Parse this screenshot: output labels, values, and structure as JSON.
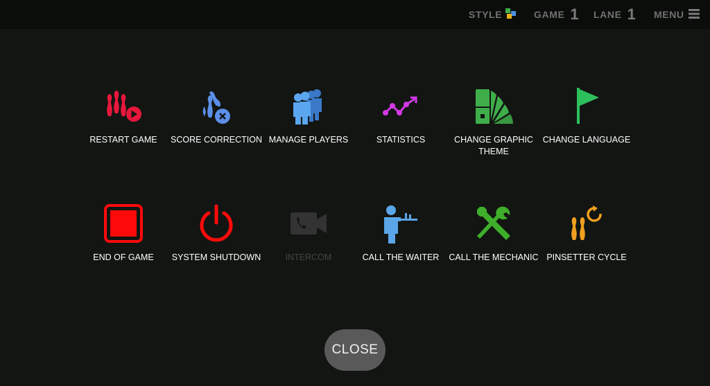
{
  "topbar": {
    "style_label": "STYLE",
    "game_label": "GAME",
    "game_value": "1",
    "lane_label": "LANE",
    "lane_value": "1",
    "menu_label": "MENU"
  },
  "menu": {
    "row1": [
      {
        "label": "RESTART GAME",
        "icon": "restart-game-icon",
        "color": "#e8173c"
      },
      {
        "label": "SCORE CORRECTION",
        "icon": "score-correction-icon",
        "color": "#5b8fe8"
      },
      {
        "label": "MANAGE PLAYERS",
        "icon": "manage-players-icon",
        "color": "#4a90e2"
      },
      {
        "label": "STATISTICS",
        "icon": "statistics-icon",
        "color": "#d23ae6"
      },
      {
        "label": "CHANGE GRAPHIC THEME",
        "icon": "graphic-theme-icon",
        "color": "#3fae4a"
      },
      {
        "label": "CHANGE LANGUAGE",
        "icon": "flag-icon",
        "color": "#2dbf5c"
      }
    ],
    "row2": [
      {
        "label": "END OF GAME",
        "icon": "stop-icon",
        "color": "#ff0a0a"
      },
      {
        "label": "SYSTEM SHUTDOWN",
        "icon": "power-icon",
        "color": "#ff0a0a"
      },
      {
        "label": "INTERCOM",
        "icon": "intercom-icon",
        "color": "#3a3a3a"
      },
      {
        "label": "CALL THE WAITER",
        "icon": "waiter-icon",
        "color": "#5aa6e8"
      },
      {
        "label": "CALL THE MECHANIC",
        "icon": "tools-icon",
        "color": "#3fae2a"
      },
      {
        "label": "PINSETTER CYCLE",
        "icon": "pinsetter-cycle-icon",
        "color": "#f0a020"
      }
    ]
  },
  "close_label": "CLOSE"
}
